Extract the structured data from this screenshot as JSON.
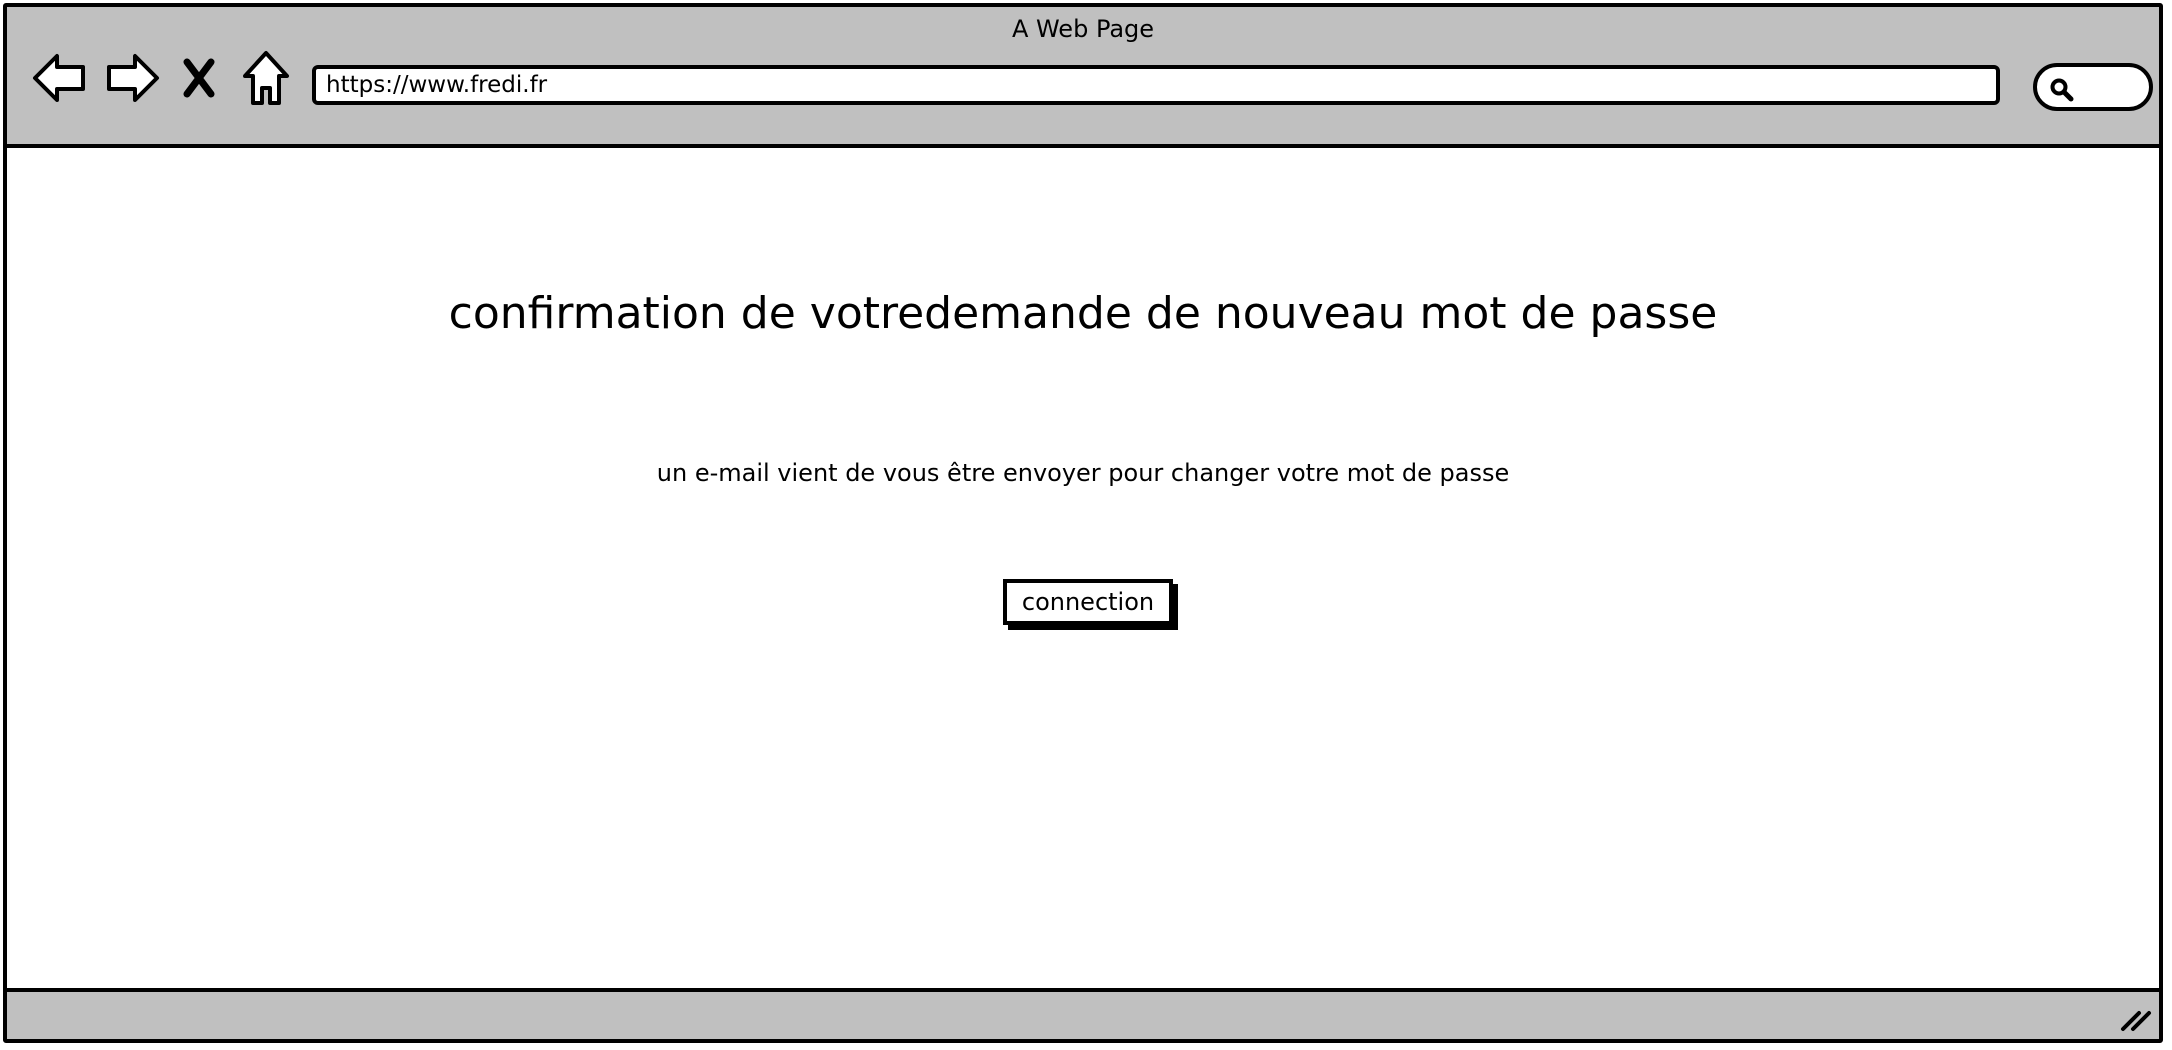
{
  "browser": {
    "window_title": "A Web Page",
    "url": "https://www.fredi.fr",
    "icons": {
      "back": "back-arrow-icon",
      "forward": "forward-arrow-icon",
      "stop": "close-x-icon",
      "home": "home-icon",
      "search": "search-icon",
      "resize": "resize-grip-icon"
    }
  },
  "main": {
    "heading": "confirmation de votredemande de nouveau mot de passe",
    "message": "un e-mail vient de vous être envoyer pour changer votre mot de passe",
    "connection_button_label": "connection"
  }
}
